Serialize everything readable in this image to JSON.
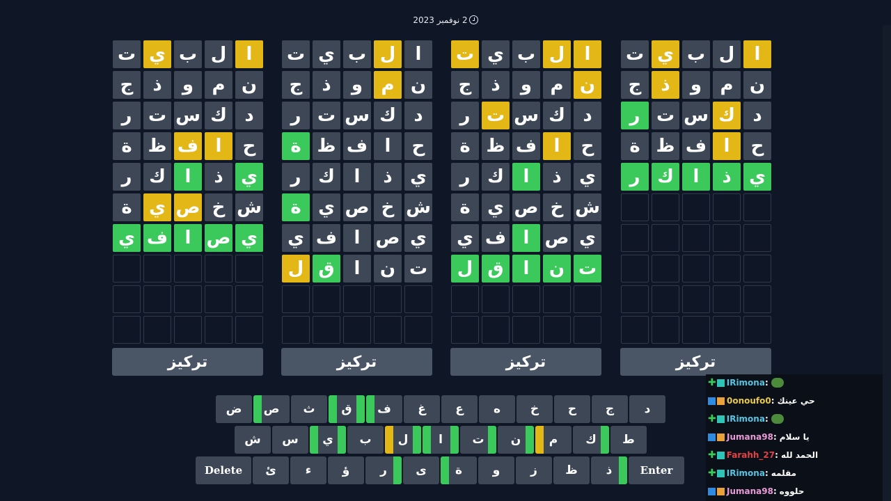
{
  "date_text": "2 نوفمبر 2023",
  "colors": {
    "filled": "#3d4756",
    "yellow": "#e3b716",
    "green": "#3cc95c",
    "empty_border": "#2f3a4b",
    "bg": "#0f1727"
  },
  "boards": [
    {
      "focus_label": "تركيز",
      "rows": [
        [
          [
            "ا",
            "y"
          ],
          [
            "ل",
            "f"
          ],
          [
            "ب",
            "f"
          ],
          [
            "ي",
            "y"
          ],
          [
            "ت",
            "f"
          ]
        ],
        [
          [
            "ن",
            "f"
          ],
          [
            "م",
            "f"
          ],
          [
            "و",
            "f"
          ],
          [
            "ذ",
            "f"
          ],
          [
            "ج",
            "f"
          ]
        ],
        [
          [
            "د",
            "f"
          ],
          [
            "ك",
            "f"
          ],
          [
            "س",
            "f"
          ],
          [
            "ت",
            "f"
          ],
          [
            "ر",
            "f"
          ]
        ],
        [
          [
            "ح",
            "f"
          ],
          [
            "ا",
            "y"
          ],
          [
            "ف",
            "y"
          ],
          [
            "ظ",
            "f"
          ],
          [
            "ة",
            "f"
          ]
        ],
        [
          [
            "ي",
            "g"
          ],
          [
            "ذ",
            "f"
          ],
          [
            "ا",
            "g"
          ],
          [
            "ك",
            "f"
          ],
          [
            "ر",
            "f"
          ]
        ],
        [
          [
            "ش",
            "f"
          ],
          [
            "خ",
            "f"
          ],
          [
            "ص",
            "y"
          ],
          [
            "ي",
            "y"
          ],
          [
            "ة",
            "f"
          ]
        ],
        [
          [
            "ي",
            "g"
          ],
          [
            "ص",
            "g"
          ],
          [
            "ا",
            "g"
          ],
          [
            "ف",
            "g"
          ],
          [
            "ي",
            "g"
          ]
        ],
        [
          [
            "",
            "e"
          ],
          [
            "",
            "e"
          ],
          [
            "",
            "e"
          ],
          [
            "",
            "e"
          ],
          [
            "",
            "e"
          ]
        ],
        [
          [
            "",
            "e"
          ],
          [
            "",
            "e"
          ],
          [
            "",
            "e"
          ],
          [
            "",
            "e"
          ],
          [
            "",
            "e"
          ]
        ],
        [
          [
            "",
            "e"
          ],
          [
            "",
            "e"
          ],
          [
            "",
            "e"
          ],
          [
            "",
            "e"
          ],
          [
            "",
            "e"
          ]
        ]
      ]
    },
    {
      "focus_label": "تركيز",
      "rows": [
        [
          [
            "ا",
            "f"
          ],
          [
            "ل",
            "y"
          ],
          [
            "ب",
            "f"
          ],
          [
            "ي",
            "f"
          ],
          [
            "ت",
            "f"
          ]
        ],
        [
          [
            "ن",
            "f"
          ],
          [
            "م",
            "y"
          ],
          [
            "و",
            "f"
          ],
          [
            "ذ",
            "f"
          ],
          [
            "ج",
            "f"
          ]
        ],
        [
          [
            "د",
            "f"
          ],
          [
            "ك",
            "f"
          ],
          [
            "س",
            "f"
          ],
          [
            "ت",
            "f"
          ],
          [
            "ر",
            "f"
          ]
        ],
        [
          [
            "ح",
            "f"
          ],
          [
            "ا",
            "f"
          ],
          [
            "ف",
            "f"
          ],
          [
            "ظ",
            "f"
          ],
          [
            "ة",
            "g"
          ]
        ],
        [
          [
            "ي",
            "f"
          ],
          [
            "ذ",
            "f"
          ],
          [
            "ا",
            "f"
          ],
          [
            "ك",
            "f"
          ],
          [
            "ر",
            "f"
          ]
        ],
        [
          [
            "ش",
            "f"
          ],
          [
            "خ",
            "f"
          ],
          [
            "ص",
            "f"
          ],
          [
            "ي",
            "f"
          ],
          [
            "ة",
            "g"
          ]
        ],
        [
          [
            "ي",
            "f"
          ],
          [
            "ص",
            "f"
          ],
          [
            "ا",
            "f"
          ],
          [
            "ف",
            "f"
          ],
          [
            "ي",
            "f"
          ]
        ],
        [
          [
            "ت",
            "f"
          ],
          [
            "ن",
            "f"
          ],
          [
            "ا",
            "f"
          ],
          [
            "ق",
            "g"
          ],
          [
            "ل",
            "y"
          ]
        ],
        [
          [
            "",
            "e"
          ],
          [
            "",
            "e"
          ],
          [
            "",
            "e"
          ],
          [
            "",
            "e"
          ],
          [
            "",
            "e"
          ]
        ],
        [
          [
            "",
            "e"
          ],
          [
            "",
            "e"
          ],
          [
            "",
            "e"
          ],
          [
            "",
            "e"
          ],
          [
            "",
            "e"
          ]
        ]
      ]
    },
    {
      "focus_label": "تركيز",
      "rows": [
        [
          [
            "ا",
            "y"
          ],
          [
            "ل",
            "y"
          ],
          [
            "ب",
            "f"
          ],
          [
            "ي",
            "f"
          ],
          [
            "ت",
            "y"
          ]
        ],
        [
          [
            "ن",
            "y"
          ],
          [
            "م",
            "f"
          ],
          [
            "و",
            "f"
          ],
          [
            "ذ",
            "f"
          ],
          [
            "ج",
            "f"
          ]
        ],
        [
          [
            "د",
            "f"
          ],
          [
            "ك",
            "f"
          ],
          [
            "س",
            "f"
          ],
          [
            "ت",
            "y"
          ],
          [
            "ر",
            "f"
          ]
        ],
        [
          [
            "ح",
            "f"
          ],
          [
            "ا",
            "y"
          ],
          [
            "ف",
            "f"
          ],
          [
            "ظ",
            "f"
          ],
          [
            "ة",
            "f"
          ]
        ],
        [
          [
            "ي",
            "f"
          ],
          [
            "ذ",
            "f"
          ],
          [
            "ا",
            "g"
          ],
          [
            "ك",
            "f"
          ],
          [
            "ر",
            "f"
          ]
        ],
        [
          [
            "ش",
            "f"
          ],
          [
            "خ",
            "f"
          ],
          [
            "ص",
            "f"
          ],
          [
            "ي",
            "f"
          ],
          [
            "ة",
            "f"
          ]
        ],
        [
          [
            "ي",
            "f"
          ],
          [
            "ص",
            "f"
          ],
          [
            "ا",
            "g"
          ],
          [
            "ف",
            "f"
          ],
          [
            "ي",
            "f"
          ]
        ],
        [
          [
            "ت",
            "g"
          ],
          [
            "ن",
            "g"
          ],
          [
            "ا",
            "g"
          ],
          [
            "ق",
            "g"
          ],
          [
            "ل",
            "g"
          ]
        ],
        [
          [
            "",
            "e"
          ],
          [
            "",
            "e"
          ],
          [
            "",
            "e"
          ],
          [
            "",
            "e"
          ],
          [
            "",
            "e"
          ]
        ],
        [
          [
            "",
            "e"
          ],
          [
            "",
            "e"
          ],
          [
            "",
            "e"
          ],
          [
            "",
            "e"
          ],
          [
            "",
            "e"
          ]
        ]
      ]
    },
    {
      "focus_label": "تركيز",
      "rows": [
        [
          [
            "ا",
            "y"
          ],
          [
            "ل",
            "f"
          ],
          [
            "ب",
            "f"
          ],
          [
            "ي",
            "y"
          ],
          [
            "ت",
            "f"
          ]
        ],
        [
          [
            "ن",
            "f"
          ],
          [
            "م",
            "f"
          ],
          [
            "و",
            "f"
          ],
          [
            "ذ",
            "y"
          ],
          [
            "ج",
            "f"
          ]
        ],
        [
          [
            "د",
            "f"
          ],
          [
            "ك",
            "y"
          ],
          [
            "س",
            "f"
          ],
          [
            "ت",
            "f"
          ],
          [
            "ر",
            "g"
          ]
        ],
        [
          [
            "ح",
            "f"
          ],
          [
            "ا",
            "y"
          ],
          [
            "ف",
            "f"
          ],
          [
            "ظ",
            "f"
          ],
          [
            "ة",
            "f"
          ]
        ],
        [
          [
            "ي",
            "g"
          ],
          [
            "ذ",
            "g"
          ],
          [
            "ا",
            "g"
          ],
          [
            "ك",
            "g"
          ],
          [
            "ر",
            "g"
          ]
        ],
        [
          [
            "",
            "e"
          ],
          [
            "",
            "e"
          ],
          [
            "",
            "e"
          ],
          [
            "",
            "e"
          ],
          [
            "",
            "e"
          ]
        ],
        [
          [
            "",
            "e"
          ],
          [
            "",
            "e"
          ],
          [
            "",
            "e"
          ],
          [
            "",
            "e"
          ],
          [
            "",
            "e"
          ]
        ],
        [
          [
            "",
            "e"
          ],
          [
            "",
            "e"
          ],
          [
            "",
            "e"
          ],
          [
            "",
            "e"
          ],
          [
            "",
            "e"
          ]
        ],
        [
          [
            "",
            "e"
          ],
          [
            "",
            "e"
          ],
          [
            "",
            "e"
          ],
          [
            "",
            "e"
          ],
          [
            "",
            "e"
          ]
        ],
        [
          [
            "",
            "e"
          ],
          [
            "",
            "e"
          ],
          [
            "",
            "e"
          ],
          [
            "",
            "e"
          ],
          [
            "",
            "e"
          ]
        ]
      ]
    }
  ],
  "keyboard": {
    "row1": [
      {
        "label": "ض",
        "bars": []
      },
      {
        "label": "ص",
        "bars": [
          [
            "l",
            "g"
          ]
        ]
      },
      {
        "label": "ث",
        "bars": []
      },
      {
        "label": "ق",
        "bars": [
          [
            "l",
            "g"
          ],
          [
            "r",
            "g"
          ]
        ]
      },
      {
        "label": "ف",
        "bars": [
          [
            "l",
            "g"
          ]
        ]
      },
      {
        "label": "غ",
        "bars": []
      },
      {
        "label": "ع",
        "bars": []
      },
      {
        "label": "ه",
        "bars": []
      },
      {
        "label": "خ",
        "bars": []
      },
      {
        "label": "ح",
        "bars": []
      },
      {
        "label": "ج",
        "bars": []
      },
      {
        "label": "د",
        "bars": []
      }
    ],
    "row2": [
      {
        "label": "ش",
        "bars": []
      },
      {
        "label": "س",
        "bars": []
      },
      {
        "label": "ي",
        "bars": [
          [
            "l",
            "g"
          ],
          [
            "r",
            "g"
          ]
        ]
      },
      {
        "label": "ب",
        "bars": []
      },
      {
        "label": "ل",
        "bars": [
          [
            "l",
            "y"
          ],
          [
            "r",
            "g"
          ]
        ]
      },
      {
        "label": "ا",
        "bars": [
          [
            "l",
            "g"
          ],
          [
            "r",
            "g"
          ]
        ]
      },
      {
        "label": "ت",
        "bars": [
          [
            "r",
            "g"
          ]
        ]
      },
      {
        "label": "ن",
        "bars": [
          [
            "r",
            "g"
          ]
        ]
      },
      {
        "label": "م",
        "bars": [
          [
            "l",
            "y"
          ]
        ]
      },
      {
        "label": "ك",
        "bars": [
          [
            "r",
            "g"
          ]
        ]
      },
      {
        "label": "ط",
        "bars": []
      }
    ],
    "row3": [
      {
        "label": "Delete",
        "bars": [],
        "wide": true
      },
      {
        "label": "ئ",
        "bars": []
      },
      {
        "label": "ء",
        "bars": []
      },
      {
        "label": "ؤ",
        "bars": []
      },
      {
        "label": "ر",
        "bars": [
          [
            "r",
            "g"
          ]
        ]
      },
      {
        "label": "ى",
        "bars": []
      },
      {
        "label": "ة",
        "bars": [
          [
            "l",
            "g"
          ]
        ]
      },
      {
        "label": "و",
        "bars": []
      },
      {
        "label": "ز",
        "bars": []
      },
      {
        "label": "ظ",
        "bars": []
      },
      {
        "label": "ذ",
        "bars": [
          [
            "r",
            "g"
          ]
        ]
      },
      {
        "label": "Enter",
        "bars": [],
        "wide": true
      }
    ]
  },
  "chat": [
    {
      "user": "IRimona",
      "message": "",
      "user_color": "#56c3e0",
      "badge": "plus",
      "emote": true
    },
    {
      "user": "0onoufo0",
      "message": "حي عينك",
      "user_color": "#e8c94a",
      "badge": "box",
      "emote": false
    },
    {
      "user": "IRimona",
      "message": "",
      "user_color": "#56c3e0",
      "badge": "plus",
      "emote": true
    },
    {
      "user": "Jumana98",
      "message": "يا سلام",
      "user_color": "#e89ad6",
      "badge": "box",
      "emote": false
    },
    {
      "user": "Farahh_27",
      "message": "الحمد لله",
      "user_color": "#e24242",
      "badge": "plus",
      "emote": false
    },
    {
      "user": "IRimona",
      "message": "مقلمه",
      "user_color": "#56c3e0",
      "badge": "plus",
      "emote": false
    },
    {
      "user": "Jumana98",
      "message": "حلووه",
      "user_color": "#e89ad6",
      "badge": "box",
      "emote": false
    }
  ]
}
